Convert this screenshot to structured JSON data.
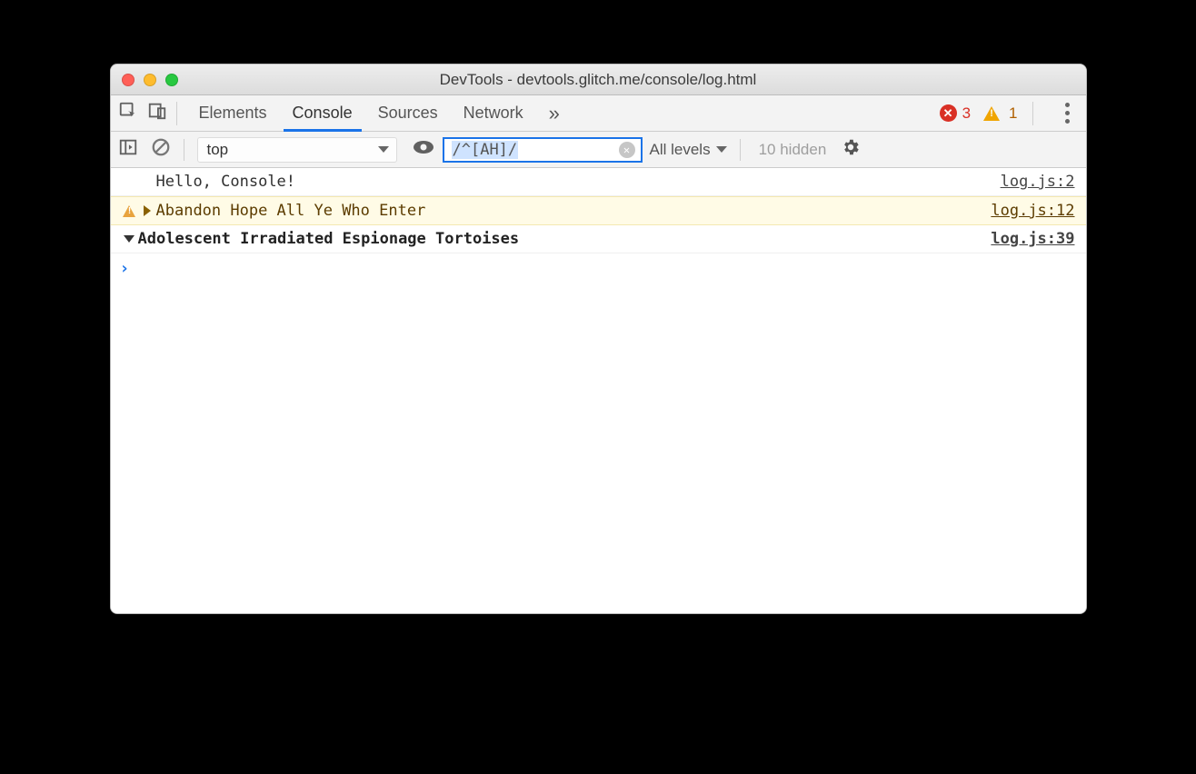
{
  "window": {
    "title": "DevTools - devtools.glitch.me/console/log.html"
  },
  "tabs": {
    "elements": "Elements",
    "console": "Console",
    "sources": "Sources",
    "network": "Network"
  },
  "errors": {
    "count": "3"
  },
  "warnings": {
    "count": "1"
  },
  "toolbar": {
    "context": "top",
    "filter_value": "/^[AH]/",
    "levels_label": "All levels",
    "hidden_label": "10 hidden"
  },
  "rows": [
    {
      "text": "Hello, Console!",
      "source": "log.js:2"
    },
    {
      "text": "Abandon Hope All Ye Who Enter",
      "source": "log.js:12"
    },
    {
      "text": "Adolescent Irradiated Espionage Tortoises",
      "source": "log.js:39"
    }
  ]
}
